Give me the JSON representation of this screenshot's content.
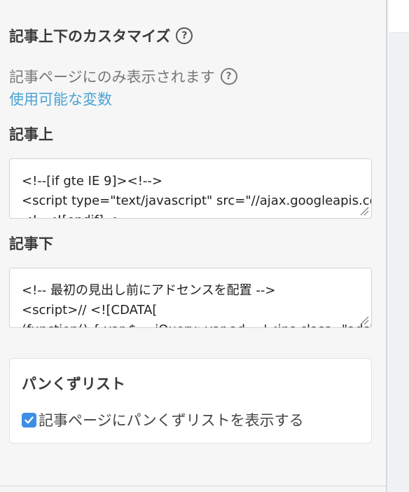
{
  "section": {
    "title": "記事上下のカスタマイズ",
    "help": "?",
    "description": "記事ページにのみ表示されます",
    "description_help": "?",
    "vars_link": "使用可能な変数"
  },
  "top_field": {
    "label": "記事上",
    "lines": [
      "<!--[if gte IE 9]><!-->",
      "<script type=\"text/javascript\" src=\"//ajax.googleapis.com/",
      "<!--<![endif]-->"
    ]
  },
  "bottom_field": {
    "label": "記事下",
    "lines": [
      "<!-- 最初の見出し前にアドセンスを配置 -->",
      "<script>// <![CDATA[",
      "(function() { var $ = jQuery; var ad = '<ins class=\"adsbygoogle\"'"
    ]
  },
  "breadcrumb": {
    "title": "パンくずリスト",
    "checkbox_label": "記事ページにパンくずリストを表示する",
    "checked": true
  },
  "colors": {
    "link": "#4aa3d4",
    "checkbox": "#3d8fe6"
  }
}
